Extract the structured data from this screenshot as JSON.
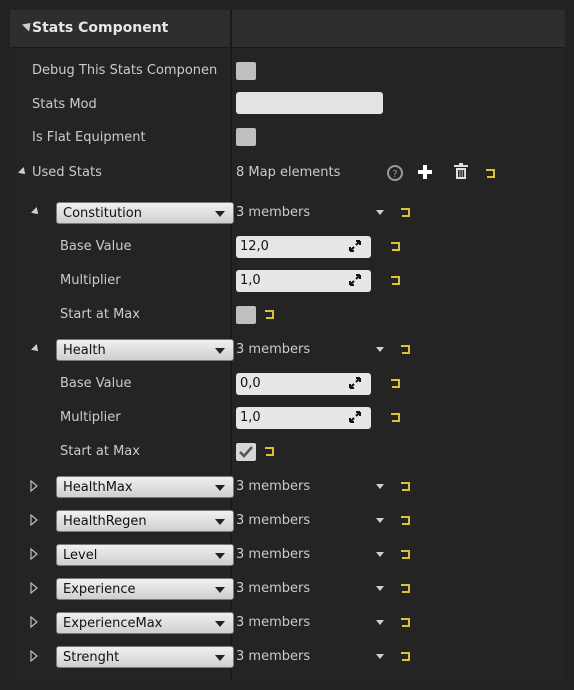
{
  "section": {
    "title": "Stats Component"
  },
  "properties": {
    "debug_label": "Debug This Stats Componen",
    "stats_mod_label": "Stats Mod",
    "is_flat_label": "Is Flat Equipment",
    "used_stats_label": "Used Stats",
    "map_elements": "8 Map elements"
  },
  "stats": [
    {
      "name": "Constitution",
      "members": "3 members",
      "expanded": true,
      "base_label": "Base Value",
      "base_value": "12,0",
      "mult_label": "Multiplier",
      "mult_value": "1,0",
      "start_label": "Start at Max",
      "start_checked": false
    },
    {
      "name": "Health",
      "members": "3 members",
      "expanded": true,
      "base_label": "Base Value",
      "base_value": "0,0",
      "mult_label": "Multiplier",
      "mult_value": "1,0",
      "start_label": "Start at Max",
      "start_checked": true
    },
    {
      "name": "HealthMax",
      "members": "3 members",
      "expanded": false
    },
    {
      "name": "HealthRegen",
      "members": "3 members",
      "expanded": false
    },
    {
      "name": "Level",
      "members": "3 members",
      "expanded": false
    },
    {
      "name": "Experience",
      "members": "3 members",
      "expanded": false
    },
    {
      "name": "ExperienceMax",
      "members": "3 members",
      "expanded": false
    },
    {
      "name": "Strenght",
      "members": "3 members",
      "expanded": false
    }
  ],
  "colors": {
    "reset_arrow": "#d9c33a",
    "panel": "#242424",
    "header": "#2e2e2e"
  },
  "icons": [
    "help-icon",
    "add-icon",
    "trash-icon",
    "reset-arrow-icon",
    "numeric-drag-icon",
    "checkmark-icon"
  ]
}
